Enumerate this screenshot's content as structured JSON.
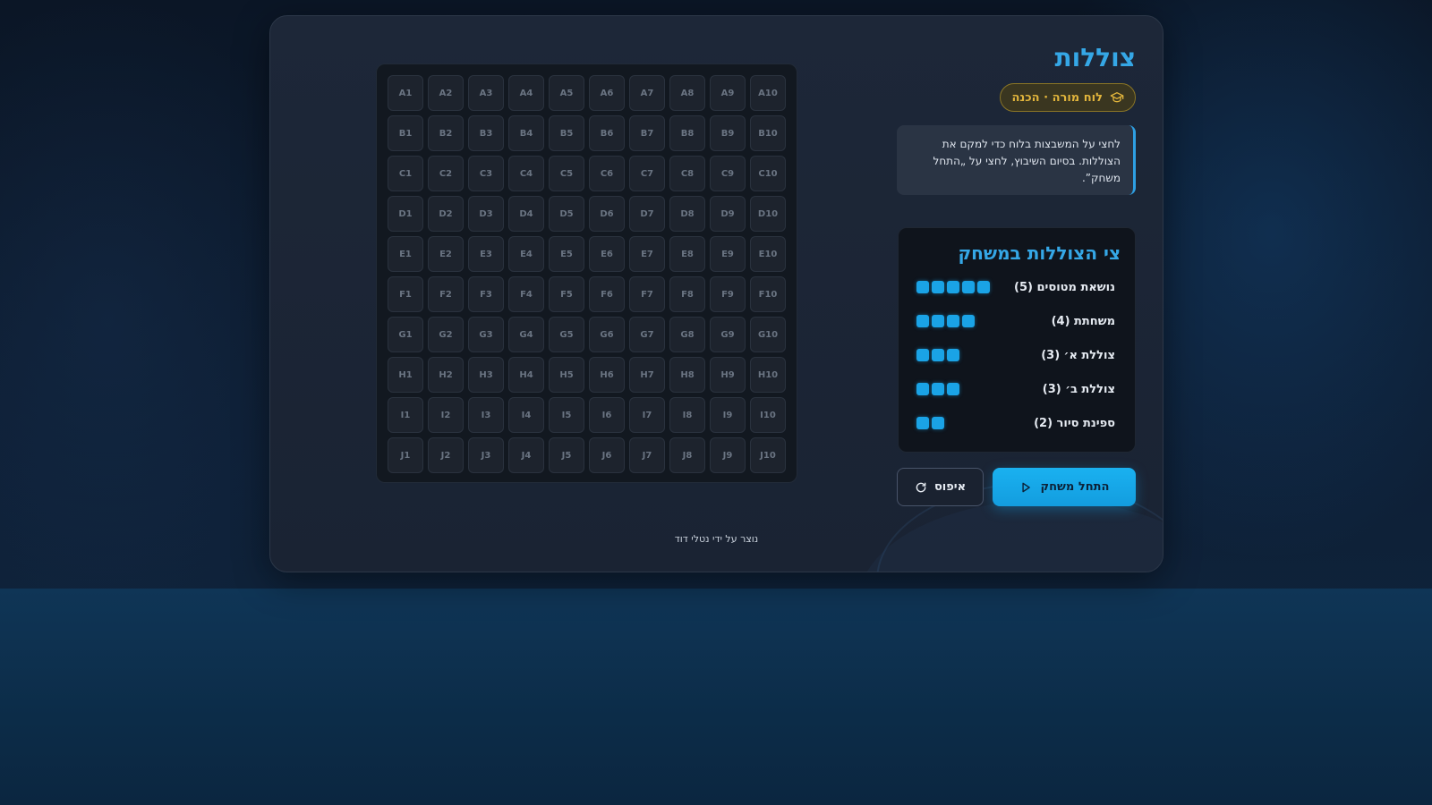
{
  "header": {
    "title": "צוללות",
    "badge_label": "לוח מורה · הכנה",
    "badge_icon": "graduation-cap-icon"
  },
  "notice": {
    "text": "לחצי על המשבצות בלוח כדי למקם את הצוללות. בסיום השיבוץ, לחצי על „התחל משחק”."
  },
  "fleet": {
    "title": "צי הצוללות במשחק",
    "ships": [
      {
        "name": "נושאת מטוסים (5)",
        "size": 5
      },
      {
        "name": "משחתת (4)",
        "size": 4
      },
      {
        "name": "צוללת א׳ (3)",
        "size": 3
      },
      {
        "name": "צוללת ב׳ (3)",
        "size": 3
      },
      {
        "name": "ספינת סיור (2)",
        "size": 2
      }
    ]
  },
  "board": {
    "rows": [
      "A",
      "B",
      "C",
      "D",
      "E",
      "F",
      "G",
      "H",
      "I",
      "J"
    ],
    "columns": [
      "1",
      "2",
      "3",
      "4",
      "5",
      "6",
      "7",
      "8",
      "9",
      "10"
    ]
  },
  "buttons": {
    "start_label": "התחל משחק",
    "reset_label": "איפוס"
  },
  "footer": {
    "credit": "נוצר על ידי נטלי דוד"
  },
  "colors": {
    "accent": "#35a7e6",
    "badge": "#e2b53c",
    "ship_block": "#1aa3e6"
  }
}
